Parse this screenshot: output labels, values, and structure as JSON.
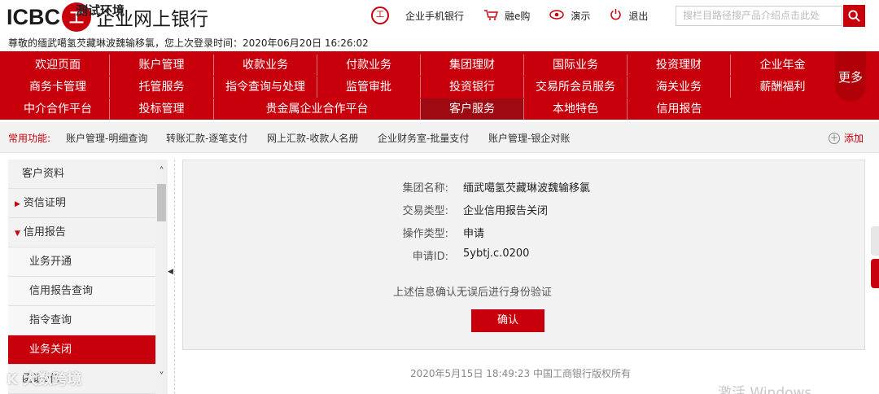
{
  "header": {
    "logo_text": "ICBC",
    "logo_glyph": "工",
    "env_label": "测试环境",
    "bank_name": "企业网上银行",
    "welcome": "尊敬的缅武噶氢芡藏琳波魏输移氯，您上次登录时间：2020年06月20日 16:26:02",
    "links": [
      {
        "icon": "mobile-bank-icon",
        "label": "企业手机银行"
      },
      {
        "icon": "cart-icon",
        "label": "融e购"
      },
      {
        "icon": "demo-eye-icon",
        "label": "演示"
      },
      {
        "icon": "power-icon",
        "label": "退出"
      }
    ],
    "search_placeholder": "搜栏目路径搜产品介绍点击此处"
  },
  "nav": {
    "rows": [
      [
        "欢迎页面",
        "账户管理",
        "收款业务",
        "付款业务",
        "集团理财",
        "国际业务",
        "投资理财",
        "企业年金"
      ],
      [
        "商务卡管理",
        "托管服务",
        "指令查询与处理",
        "监管审批",
        "投资银行",
        "交易所会员服务",
        "海关业务",
        "薪酬福利"
      ],
      [
        "中介合作平台",
        "投标管理",
        "贵金属企业合作平台",
        "客户服务",
        "本地特色",
        "信用报告"
      ]
    ],
    "more": "更多"
  },
  "quick": {
    "label": "常用功能:",
    "items": [
      "账户管理-明细查询",
      "转账汇款-逐笔支付",
      "网上汇款-收款人名册",
      "企业财务室-批量支付",
      "账户管理-银企对账"
    ],
    "add": "添加"
  },
  "sidebar": {
    "items": [
      {
        "label": "客户资料"
      },
      {
        "label": "资信证明"
      },
      {
        "label": "信用报告"
      },
      {
        "label": "业务开通"
      },
      {
        "label": "信用报告查询"
      },
      {
        "label": "指令查询"
      },
      {
        "label": "业务关闭"
      },
      {
        "label": "函证e信"
      }
    ]
  },
  "form": {
    "fields": [
      {
        "label": "集团名称:",
        "value": "缅武噶氢芡藏琳波魏输移氯"
      },
      {
        "label": "交易类型:",
        "value": "企业信用报告关闭"
      },
      {
        "label": "操作类型:",
        "value": "申请"
      },
      {
        "label": "申请ID:",
        "value": "5ybtj.c.0200"
      }
    ],
    "confirm_text": "上述信息确认无误后进行身份验证",
    "confirm_button": "确认"
  },
  "footer": "2020年5月15日 18:49:23    中国工商银行版权所有",
  "watermark": "K 大数跨境",
  "activate": "激活 Windows",
  "colors": {
    "brand": "#c7000b",
    "nav_active": "#9f0a12"
  }
}
